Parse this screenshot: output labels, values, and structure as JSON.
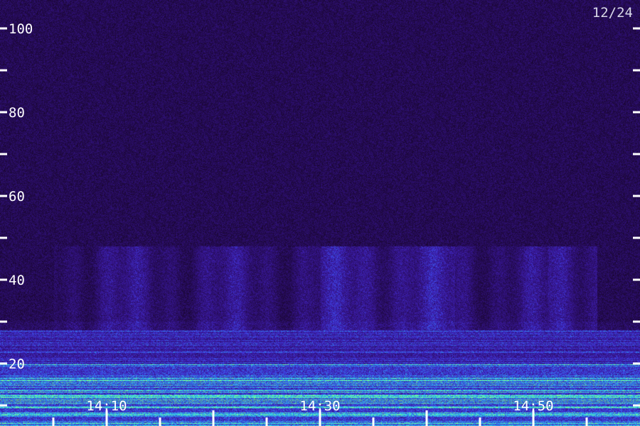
{
  "chart_data": {
    "type": "heatmap",
    "title": "",
    "date_label": "12/24",
    "xlabel": "",
    "ylabel": "",
    "y_range": [
      0,
      105
    ],
    "y_ticks_labeled": [
      100,
      80,
      60,
      40,
      20
    ],
    "y_ticks_minor": [
      90,
      70,
      50,
      30,
      10
    ],
    "x_range": [
      "14:00",
      "15:00"
    ],
    "x_ticks_labeled": [
      "14:10",
      "14:30",
      "14:50"
    ],
    "x_tick_minutes": [
      5,
      10,
      15,
      20,
      25,
      30,
      35,
      40,
      45,
      50,
      55
    ],
    "colormap": [
      "#1a0633",
      "#2a0e66",
      "#3a1aa0",
      "#3e3ee0",
      "#2f8fe8",
      "#33d4e8",
      "#7cff8a"
    ],
    "features": {
      "strong_band_y": [
        0,
        20
      ],
      "moderate_band_y": [
        20,
        28
      ],
      "burst_band_y": [
        28,
        48
      ],
      "burst_time_range": [
        "14:05",
        "14:56"
      ]
    }
  }
}
